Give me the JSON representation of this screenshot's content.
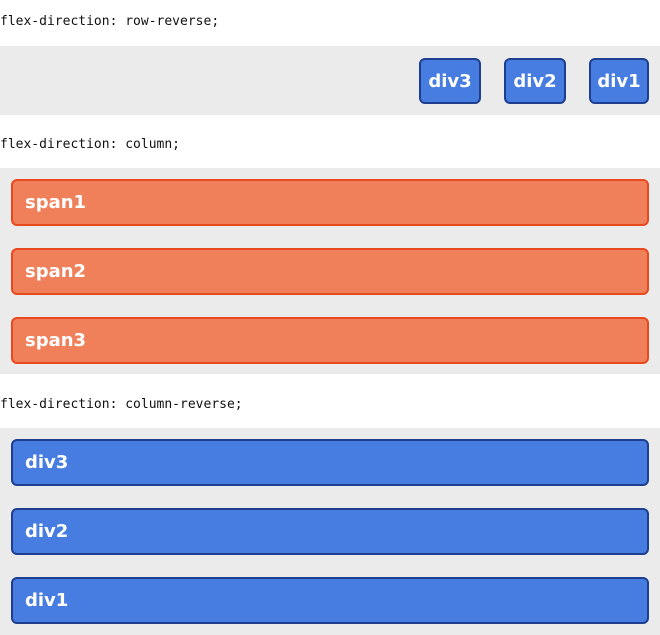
{
  "sections": {
    "row_reverse": {
      "caption": "flex-direction: row-reverse;",
      "items": [
        "div3",
        "div2",
        "div1"
      ]
    },
    "column": {
      "caption": "flex-direction: column;",
      "items": [
        "span1",
        "span2",
        "span3"
      ]
    },
    "column_reverse": {
      "caption": "flex-direction: column-reverse;",
      "items": [
        "div3",
        "div2",
        "div1"
      ]
    }
  },
  "colors": {
    "band": "#ebebeb",
    "blue_fill": "#477de0",
    "blue_border": "#1e3f8f",
    "orange_fill": "#f0805a",
    "orange_border": "#e8491f"
  }
}
